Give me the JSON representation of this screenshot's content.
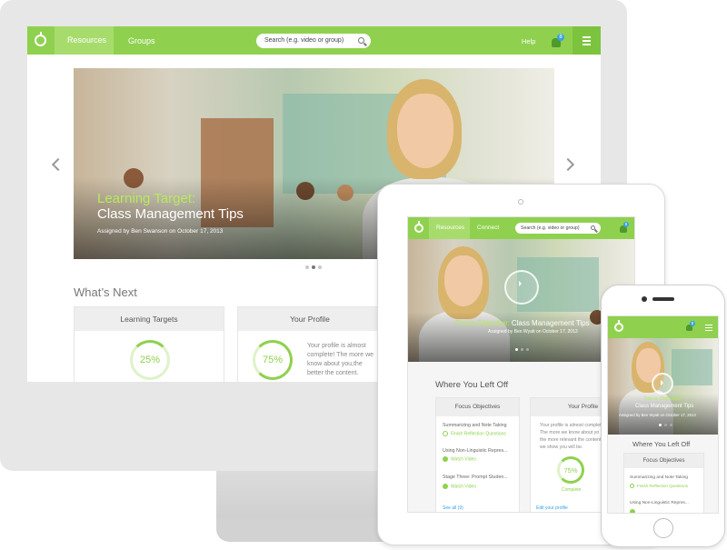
{
  "desktop": {
    "nav": {
      "resources": "Resources",
      "groups": "Groups",
      "search_placeholder": "Search (e.g. video or group)",
      "help": "Help",
      "badge": "8"
    },
    "hero": {
      "title_green": "Learning Target:",
      "title": "Class Management Tips",
      "assigned": "Assigned by Ben Swanson on October 17, 2013"
    },
    "section_title": "What’s Next",
    "cards": {
      "learning_targets": {
        "title": "Learning Targets",
        "percent": "25%",
        "progress": 0.25
      },
      "profile": {
        "title": "Your Profile",
        "percent": "75%",
        "progress": 0.75,
        "text_1": "Your profile is almost",
        "text_2": "complete! The more we",
        "text_3": "know about you,the",
        "text_4": "better the content."
      }
    }
  },
  "tablet": {
    "nav": {
      "resources": "Resources",
      "connect": "Connect",
      "search_placeholder": "Search (e.g. video or group)",
      "badge": "8"
    },
    "hero": {
      "title_green": "Focus Objective:",
      "title": "Class Management Tips",
      "assigned": "Assigned by Ben Wyatt on October 17, 2013"
    },
    "section_title": "Where You Left Off",
    "focus": {
      "title": "Focus Objectives",
      "items": [
        {
          "label": "Summarizing and Note Taking",
          "action": "Finish Reflection Questions"
        },
        {
          "label": "Using Non-Linguistic Repres...",
          "action": "Watch Video"
        },
        {
          "label": "Stage Three: Prompt Studen...",
          "action": "Watch Video"
        }
      ],
      "see_all": "See all (9)"
    },
    "profile": {
      "title": "Your Profile",
      "text_1": "Your profile is almost complet",
      "text_2": "The more we know about yo",
      "text_3": "the more relevant the content",
      "text_4": "we show you will be.",
      "percent": "75%",
      "progress": 0.75,
      "status": "Complete",
      "edit": "Edit your profile"
    }
  },
  "phone": {
    "nav": {
      "badge": "8"
    },
    "hero": {
      "title_green": "Focus Objective:",
      "title": "Class Management Tips",
      "assigned": "Assigned by Ben Wyatt on October 17, 2013"
    },
    "section_title": "Where You Left Off",
    "focus": {
      "title": "Focus Objectives",
      "items": [
        {
          "label": "Summarizing and Note Taking",
          "action": "Finish Reflection Questions"
        },
        {
          "label": "Using Non-Linguistic Repres..."
        }
      ]
    }
  },
  "colors": {
    "brand_green": "#8fd14f",
    "accent_blue": "#3aa0e8"
  }
}
